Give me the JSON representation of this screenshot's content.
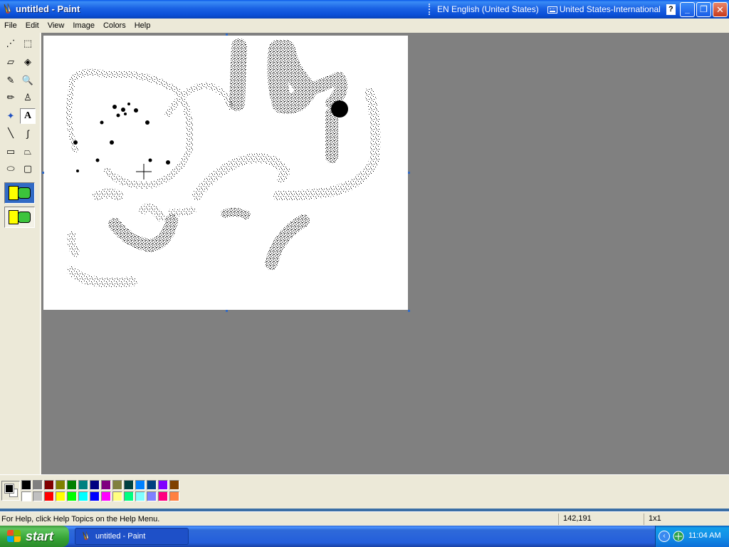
{
  "window": {
    "title": "untitled - Paint",
    "minimize_label": "_",
    "maximize_label": "❐",
    "close_label": "✕"
  },
  "language_bar": {
    "language": "EN English (United States)",
    "keyboard": "United States-International",
    "help": "?",
    "options": "⌄"
  },
  "menu": {
    "items": [
      "File",
      "Edit",
      "View",
      "Image",
      "Colors",
      "Help"
    ]
  },
  "tools": [
    {
      "name": "free-form-select",
      "icon": "⋰"
    },
    {
      "name": "rectangle-select",
      "icon": "⬚"
    },
    {
      "name": "eraser",
      "icon": "▱"
    },
    {
      "name": "fill",
      "icon": "◈"
    },
    {
      "name": "pick-color",
      "icon": "✎"
    },
    {
      "name": "magnifier",
      "icon": "🔍"
    },
    {
      "name": "pencil",
      "icon": "✏"
    },
    {
      "name": "brush",
      "icon": "♙"
    },
    {
      "name": "airbrush",
      "icon": "✦"
    },
    {
      "name": "text",
      "icon": "A"
    },
    {
      "name": "line",
      "icon": "╲"
    },
    {
      "name": "curve",
      "icon": "∫"
    },
    {
      "name": "rectangle",
      "icon": "▭"
    },
    {
      "name": "polygon",
      "icon": "⏢"
    },
    {
      "name": "ellipse",
      "icon": "⬭"
    },
    {
      "name": "rounded-rectangle",
      "icon": "▢"
    }
  ],
  "active_tool": "text",
  "palette": {
    "foreground": "#000000",
    "background": "#ffffff",
    "row1": [
      "#000000",
      "#808080",
      "#800000",
      "#808000",
      "#008000",
      "#008080",
      "#000080",
      "#800080",
      "#808040",
      "#004040",
      "#0080ff",
      "#004080",
      "#8000ff",
      "#804000"
    ],
    "row2": [
      "#ffffff",
      "#c0c0c0",
      "#ff0000",
      "#ffff00",
      "#00ff00",
      "#00ffff",
      "#0000ff",
      "#ff00ff",
      "#ffff80",
      "#00ff80",
      "#80ffff",
      "#8080ff",
      "#ff0080",
      "#ff8040"
    ]
  },
  "status": {
    "help_text": "For Help, click Help Topics on the Help Menu.",
    "cursor_position": "142,191",
    "selection_size": "1x1"
  },
  "taskbar": {
    "start_label": "start",
    "task_label": "untitled - Paint",
    "clock": "11:04 AM",
    "tray_arrow": "‹"
  }
}
